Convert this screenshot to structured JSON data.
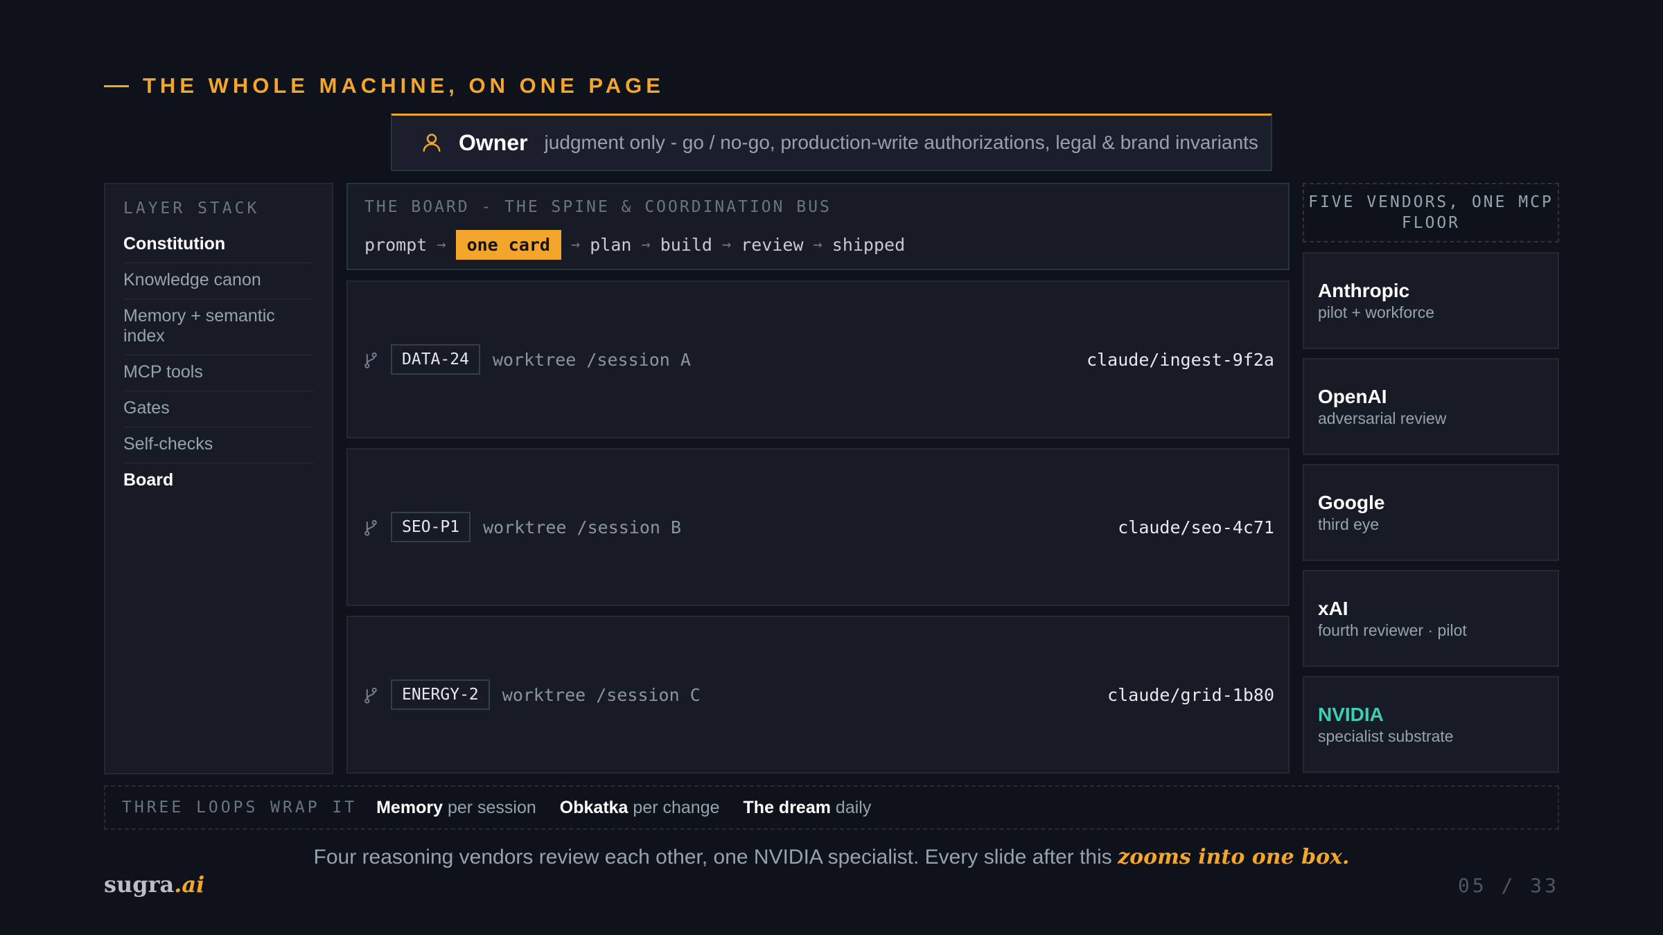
{
  "eyebrow": "THE WHOLE MACHINE, ON ONE PAGE",
  "owner": {
    "title": "Owner",
    "description": "judgment only - go / no-go, production-write authorizations, legal & brand invariants"
  },
  "layer_stack": {
    "header": "LAYER STACK",
    "items": [
      {
        "label": "Constitution",
        "bold": true
      },
      {
        "label": "Knowledge canon"
      },
      {
        "label": "Memory + semantic index"
      },
      {
        "label": "MCP tools"
      },
      {
        "label": "Gates"
      },
      {
        "label": "Self-checks"
      },
      {
        "label": "Board",
        "bold": true
      }
    ]
  },
  "board": {
    "header": "THE BOARD - THE SPINE & COORDINATION BUS",
    "flow": [
      "prompt",
      "one card",
      "plan",
      "build",
      "review",
      "shipped"
    ],
    "arrow": "→"
  },
  "sessions": [
    {
      "tag": "DATA-24",
      "worktree": "worktree /session A",
      "branch": "claude/ingest-9f2a"
    },
    {
      "tag": "SEO-P1",
      "worktree": "worktree /session B",
      "branch": "claude/seo-4c71"
    },
    {
      "tag": "ENERGY-2",
      "worktree": "worktree /session C",
      "branch": "claude/grid-1b80"
    }
  ],
  "vendors": {
    "header": "FIVE VENDORS, ONE MCP FLOOR",
    "items": [
      {
        "name": "Anthropic",
        "sub": "pilot + workforce"
      },
      {
        "name": "OpenAI",
        "sub": "adversarial review"
      },
      {
        "name": "Google",
        "sub": "third eye"
      },
      {
        "name": "xAI",
        "sub": "fourth reviewer · pilot"
      },
      {
        "name": "NVIDIA",
        "sub": "specialist substrate"
      }
    ]
  },
  "loops": {
    "header": "THREE LOOPS WRAP IT",
    "items": [
      {
        "name": "Memory",
        "cadence": "per session"
      },
      {
        "name": "Obkatka",
        "cadence": "per change"
      },
      {
        "name": "The dream",
        "cadence": "daily"
      }
    ]
  },
  "caption": {
    "text": "Four reasoning vendors review each other, one NVIDIA specialist. Every slide after this",
    "emphasis": "zooms into one box."
  },
  "logo": {
    "word": "sugra",
    "suffix": ".ai"
  },
  "page_number": "05 / 33",
  "colors": {
    "accent": "#f4a52b",
    "nvidia": "#3ecfb0",
    "background": "#0e121b"
  },
  "icons": {
    "owner": "person-icon",
    "session": "git-branch-icon"
  }
}
